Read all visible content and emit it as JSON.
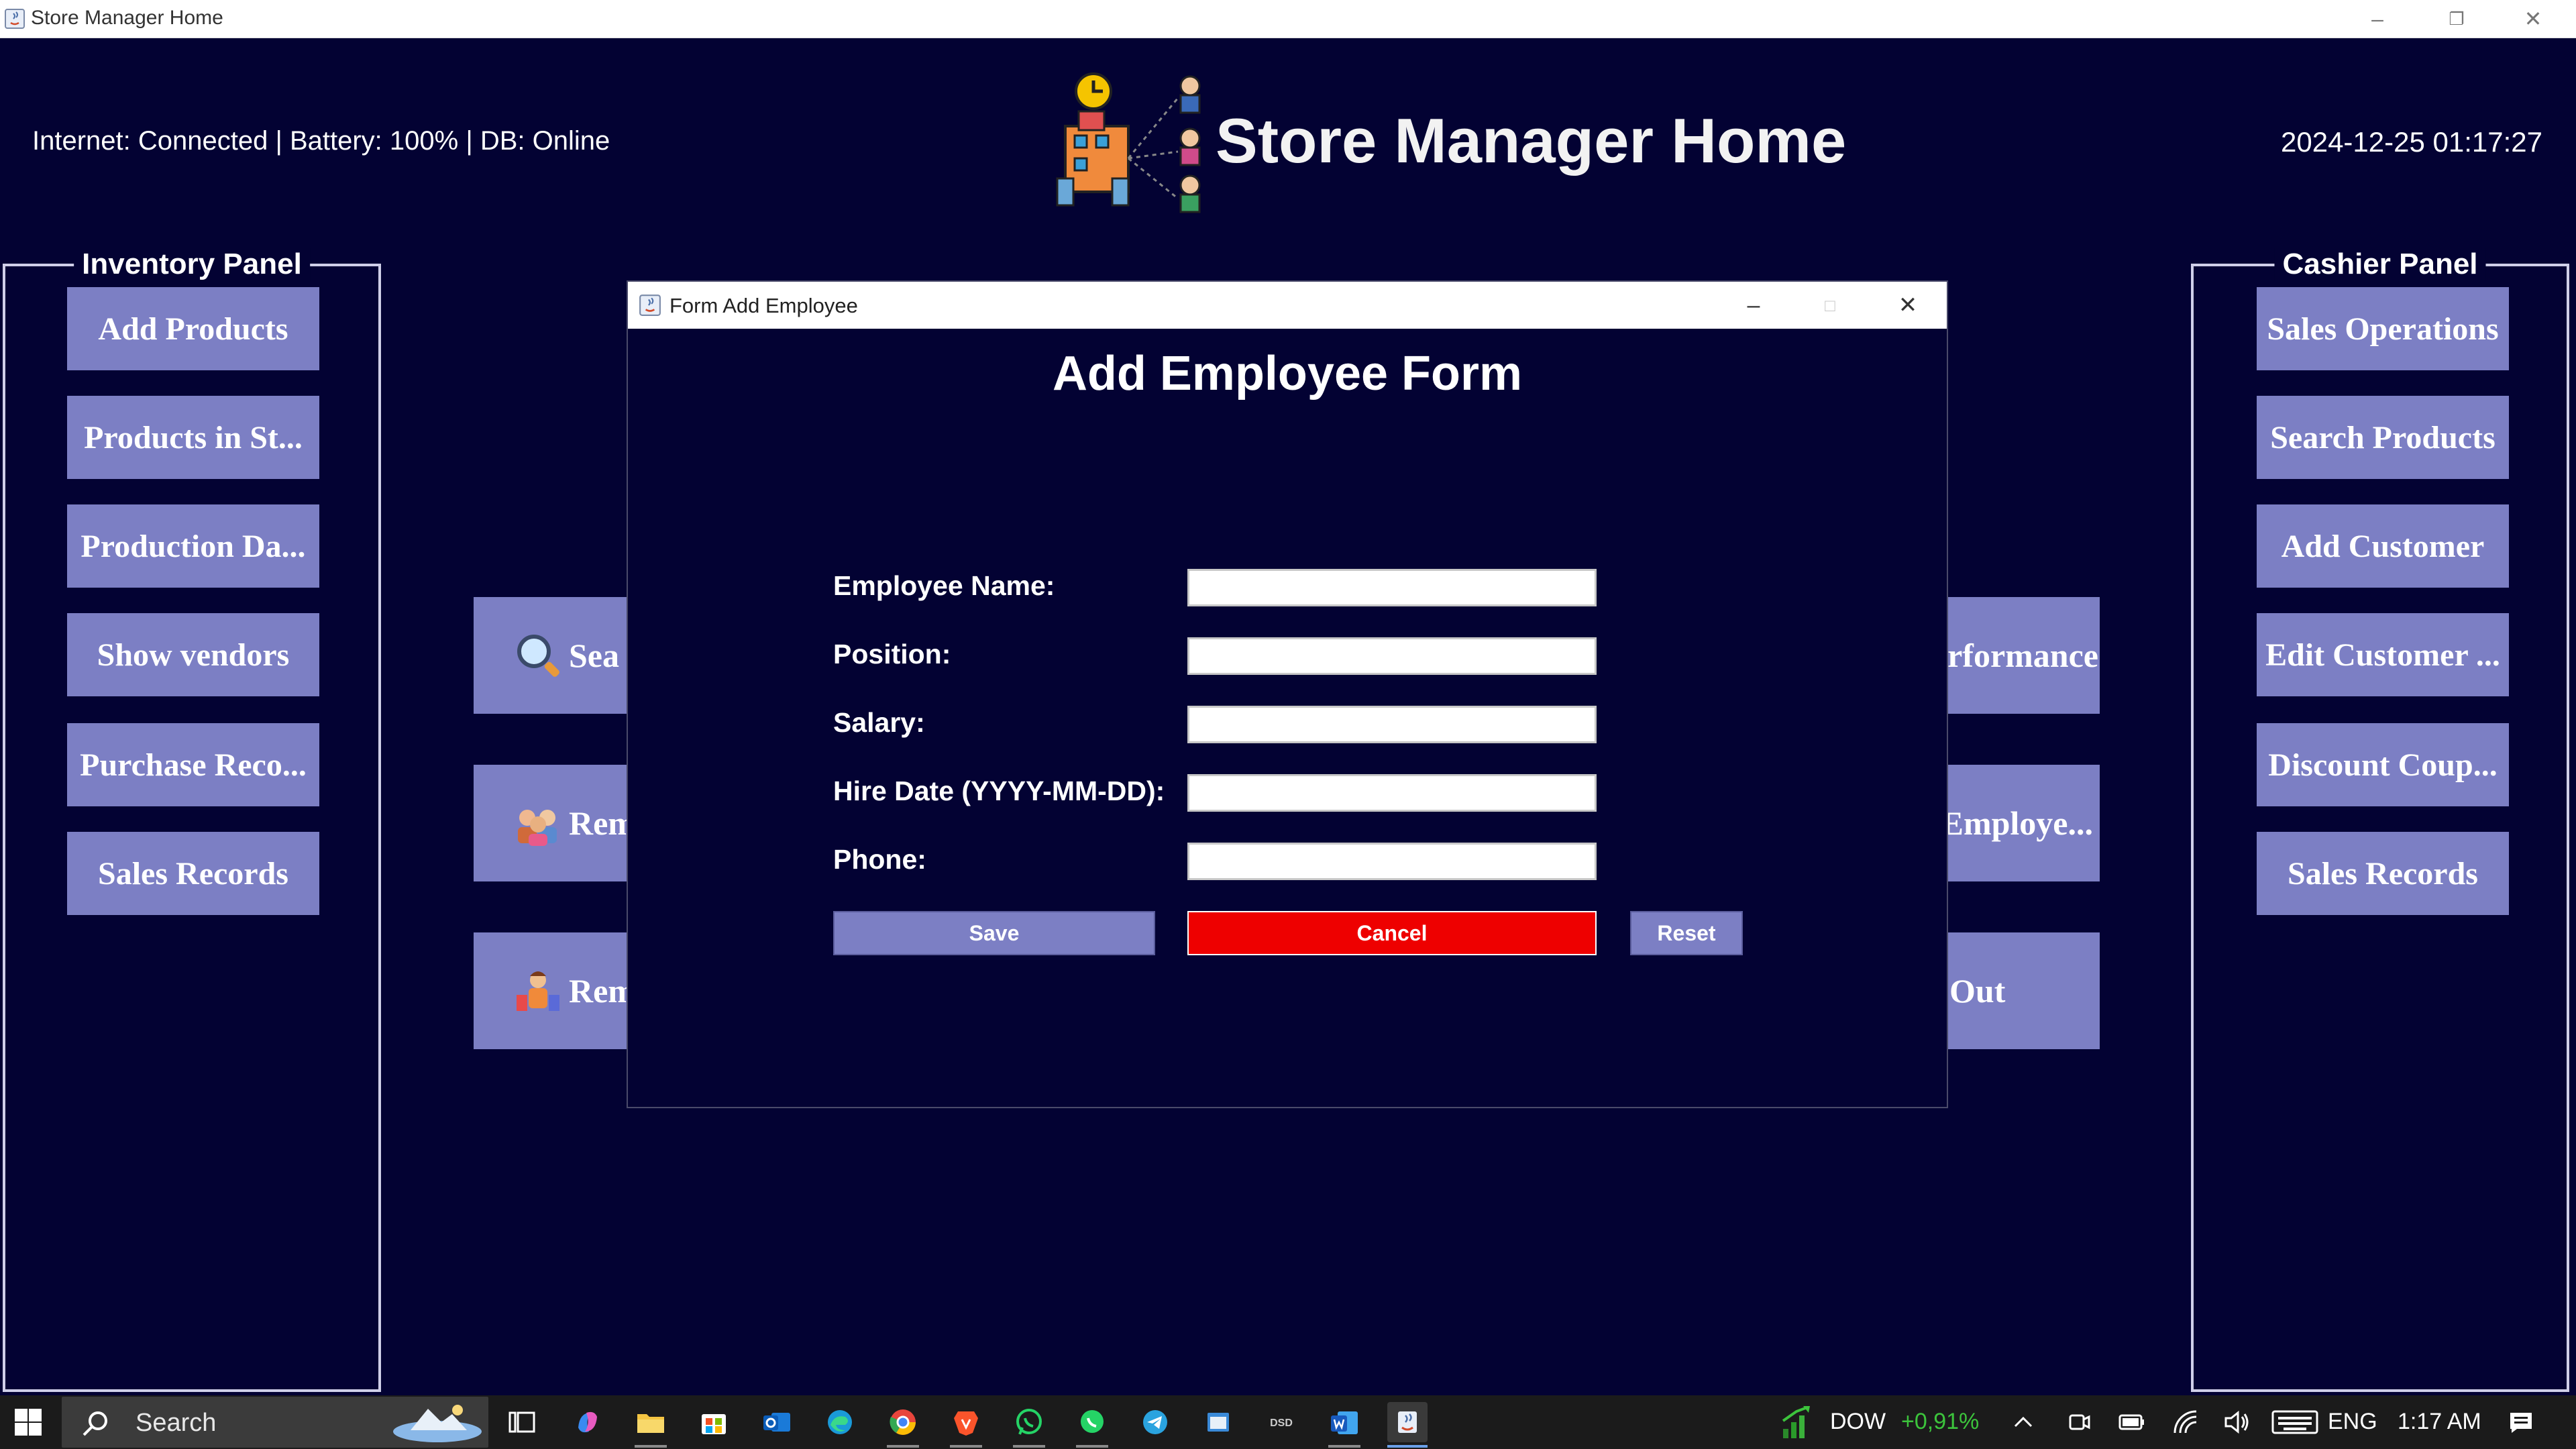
{
  "window": {
    "title": "Store Manager Home",
    "controls": {
      "minimize": "–",
      "restore": "❐",
      "close": "✕"
    }
  },
  "header": {
    "status": "Internet: Connected | Battery: 100% | DB:  Online",
    "app_title": "Store Manager Home",
    "datetime": "2024-12-25 01:17:27"
  },
  "inventory_panel": {
    "title": "Inventory Panel",
    "buttons": [
      "Add Products",
      "Products in St...",
      "Production Da...",
      "Show vendors",
      "Purchase Reco...",
      "Sales Records"
    ]
  },
  "cashier_panel": {
    "title": "Cashier Panel",
    "buttons": [
      "Sales Operations",
      "Search Products",
      "Add Customer",
      "Edit Customer ...",
      "Discount Coup...",
      "Sales Records"
    ]
  },
  "center_tiles": {
    "left": [
      "Sea",
      "Rem",
      "Rem"
    ],
    "right": [
      "rformance",
      "Employe...",
      "Out"
    ]
  },
  "dialog": {
    "window_title": "Form Add Employee",
    "form_title": "Add Employee Form",
    "fields": [
      {
        "label": "Employee Name:",
        "value": ""
      },
      {
        "label": "Position:",
        "value": ""
      },
      {
        "label": "Salary:",
        "value": ""
      },
      {
        "label": "Hire Date (YYYY-MM-DD):",
        "value": ""
      },
      {
        "label": "Phone:",
        "value": ""
      }
    ],
    "buttons": {
      "save": "Save",
      "cancel": "Cancel",
      "reset": "Reset"
    },
    "colors": {
      "save": "#7c7fc4",
      "cancel": "#ee0000",
      "reset": "#7c7fc4"
    }
  },
  "taskbar": {
    "search_label": "Search",
    "ticker_name": "DOW",
    "ticker_change": "+0,91%",
    "language": "ENG",
    "time": "1:17 AM"
  },
  "colors": {
    "background": "#030233",
    "button": "#7c7fc4",
    "panel_border": "#cfcfe8",
    "ticker_up": "#3cc43c"
  }
}
